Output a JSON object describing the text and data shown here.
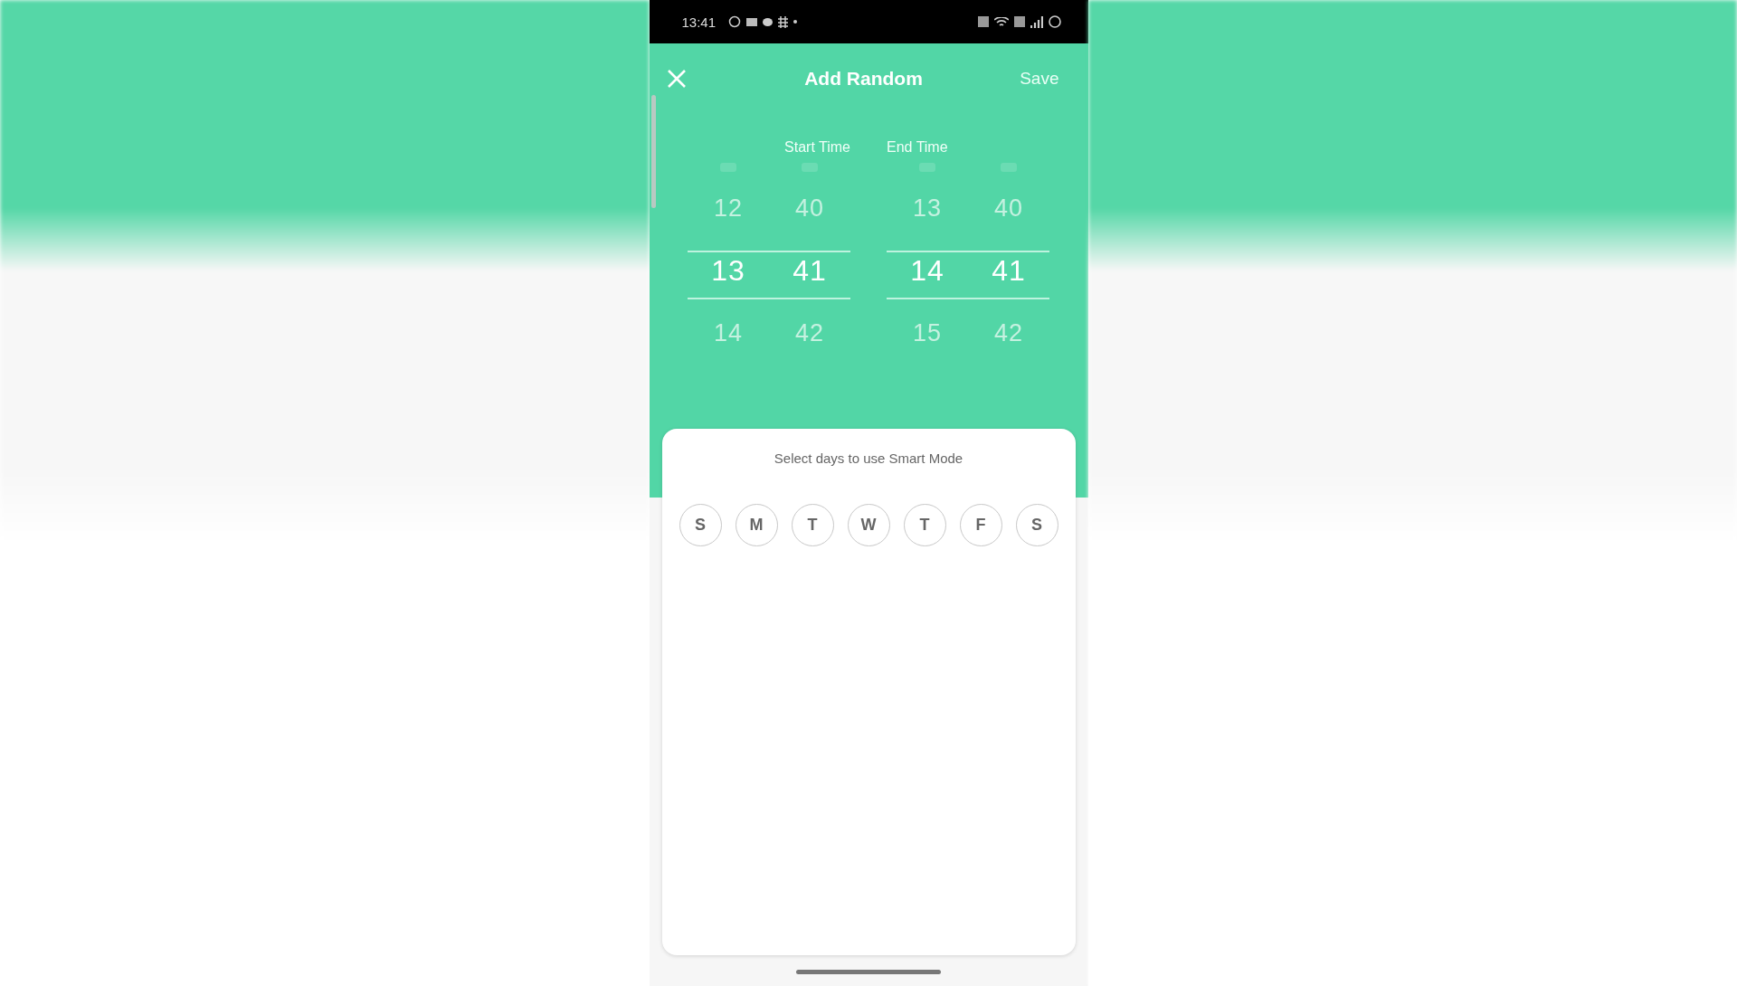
{
  "status_bar": {
    "time": "13:41"
  },
  "header": {
    "title": "Add Random",
    "save": "Save"
  },
  "pickers": [
    {
      "label": "Start Time",
      "columns": [
        {
          "values": [
            {
              "text": "12",
              "selected": false
            },
            {
              "text": "13",
              "selected": true
            },
            {
              "text": "14",
              "selected": false
            }
          ]
        },
        {
          "values": [
            {
              "text": "40",
              "selected": false
            },
            {
              "text": "41",
              "selected": true
            },
            {
              "text": "42",
              "selected": false
            }
          ]
        }
      ]
    },
    {
      "label": "End Time",
      "columns": [
        {
          "values": [
            {
              "text": "13",
              "selected": false
            },
            {
              "text": "14",
              "selected": true
            },
            {
              "text": "15",
              "selected": false
            }
          ]
        },
        {
          "values": [
            {
              "text": "40",
              "selected": false
            },
            {
              "text": "41",
              "selected": true
            },
            {
              "text": "42",
              "selected": false
            }
          ]
        }
      ]
    }
  ],
  "days_card": {
    "title": "Select days to use Smart Mode",
    "days": [
      {
        "label": "S",
        "selected": false
      },
      {
        "label": "M",
        "selected": false
      },
      {
        "label": "T",
        "selected": false
      },
      {
        "label": "W",
        "selected": false
      },
      {
        "label": "T",
        "selected": false
      },
      {
        "label": "F",
        "selected": false
      },
      {
        "label": "S",
        "selected": false
      }
    ]
  }
}
